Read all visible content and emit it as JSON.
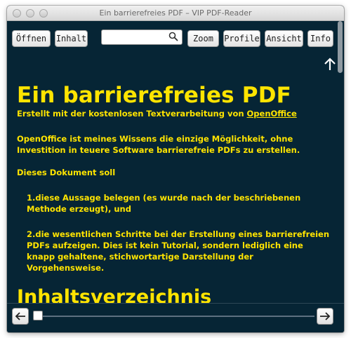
{
  "window": {
    "title": "Ein barrierefreies PDF – VIP PDF-Reader"
  },
  "toolbar": {
    "open_label": "Öffnen",
    "contents_label": "Inhalt",
    "search_value": "",
    "zoom_label": "Zoom",
    "profiles_label": "Profile",
    "view_label": "Ansicht",
    "info_label": "Info"
  },
  "icons": {
    "search": "magnifier-icon",
    "scroll_up": "arrow-up-icon",
    "prev": "arrow-left-icon",
    "next": "arrow-right-icon"
  },
  "document": {
    "title": "Ein barrierefreies PDF",
    "subtitle_prefix": "Erstellt mit der kostenlosen Textverarbeitung von ",
    "subtitle_link": "OpenOffice",
    "paragraph1": "OpenOffice ist meines Wissens die einzige Möglichkeit, ohne Investition in teuere Software barrierefreie PDFs zu erstellen.",
    "paragraph2": "Dieses Dokument soll",
    "list": [
      "1.diese Aussage belegen (es wurde nach der beschriebenen Methode erzeugt), und",
      "2.die wesentlichen Schritte bei der Erstellung eines barrierefreien PDFs aufzeigen. Dies ist kein Tutorial, sondern lediglich eine knapp gehaltene, stichwortartige Darstellung der Vorgehensweise."
    ],
    "heading2": "Inhaltsverzeichnis"
  },
  "colors": {
    "background": "#062535",
    "text": "#ffe400"
  }
}
